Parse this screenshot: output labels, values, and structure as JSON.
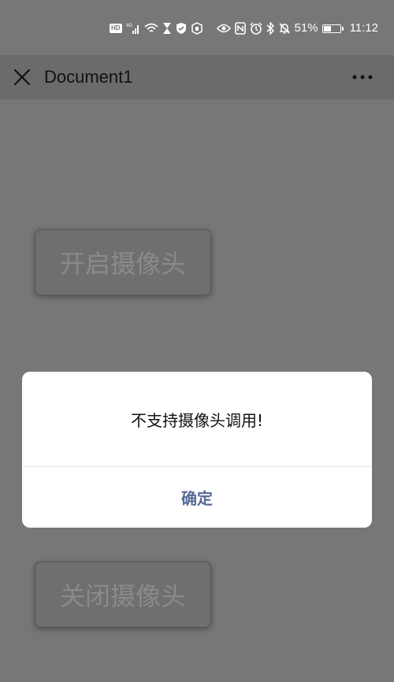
{
  "status_bar": {
    "hd_label": "HD",
    "network_label": "4G",
    "battery_percent": "51%",
    "battery_level": 0.51,
    "time": "11:12",
    "icons": [
      "hd-icon",
      "signal-icon",
      "wifi-icon",
      "hourglass-icon",
      "shield-check-icon",
      "hand-shield-icon",
      "eye-icon",
      "nfc-icon",
      "alarm-icon",
      "bluetooth-icon",
      "mute-icon",
      "battery-icon"
    ]
  },
  "title_bar": {
    "close_icon": "close-icon",
    "title": "Document1",
    "more_icon": "more-horizontal-icon"
  },
  "page": {
    "open_camera_label": "开启摄像头",
    "close_camera_label": "关闭摄像头"
  },
  "dialog": {
    "message": "不支持摄像头调用!",
    "confirm_label": "确定"
  },
  "colors": {
    "overlay_background": "#777777",
    "title_bar_background": "#6b6b6b",
    "dialog_background": "#ffffff",
    "confirm_text": "#576b95"
  }
}
